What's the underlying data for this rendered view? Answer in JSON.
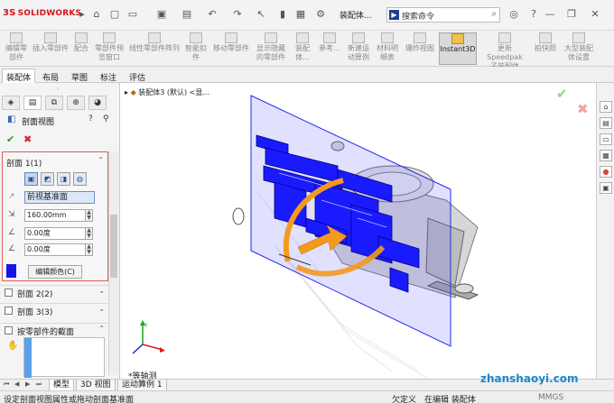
{
  "app": {
    "logo_prefix": "3S",
    "logo_text": "SOLIDWORKS",
    "doc_title": "装配体...",
    "search_placeholder": "搜索命令"
  },
  "ribbon": {
    "items": [
      {
        "label": "编辑零\n部件",
        "active": false
      },
      {
        "label": "插入零部件",
        "active": false
      },
      {
        "label": "配合",
        "active": false
      },
      {
        "label": "零部件预\n览窗口",
        "active": false
      },
      {
        "label": "线性零部件阵列",
        "active": false
      },
      {
        "label": "智能扣\n件",
        "active": false
      },
      {
        "label": "移动零部件",
        "active": false
      },
      {
        "label": "显示隐藏\n的零部件",
        "active": false
      },
      {
        "label": "装配体...",
        "active": false
      },
      {
        "label": "参考...",
        "active": false
      },
      {
        "label": "新建运\n动算例",
        "active": false
      },
      {
        "label": "材料明\n细表",
        "active": false
      },
      {
        "label": "爆炸视图",
        "active": false
      },
      {
        "label": "Instant3D",
        "active": true
      },
      {
        "label": "更新 Speedpak\n子装配体",
        "active": false
      },
      {
        "label": "拍快照",
        "active": false
      },
      {
        "label": "大型装配\n体设置",
        "active": false
      }
    ]
  },
  "command_tabs": [
    "装配体",
    "布局",
    "草图",
    "标注",
    "评估"
  ],
  "property_manager": {
    "title": "剖面视图",
    "section1": {
      "title": "剖面 1(1)",
      "reference_plane": "前视基准面",
      "offset": "160.00mm",
      "angle_x": "0.00度",
      "angle_y": "0.00度",
      "edit_color_label": "编辑颜色(C)",
      "section_color": "#1515e8"
    },
    "section2_label": "剖面 2(2)",
    "section3_label": "剖面 3(3)",
    "by_component_label": "按零部件的截面"
  },
  "graphics": {
    "tree_flyout": "装配体3 (默认) <显...",
    "view_orientation": "*等轴测"
  },
  "model_tabs": [
    "模型",
    "3D 视图",
    "运动算例 1"
  ],
  "status": {
    "message": "设定剖面视图属性或拖动剖面基准面",
    "definition": "欠定义",
    "editing": "在编辑 装配体",
    "units": "MMGS"
  },
  "watermark": "zhanshaoyi.com",
  "colors": {
    "accent_red": "#d5141b",
    "section_plane": "#1a1aff",
    "rotate_handle": "#f39a1e"
  }
}
